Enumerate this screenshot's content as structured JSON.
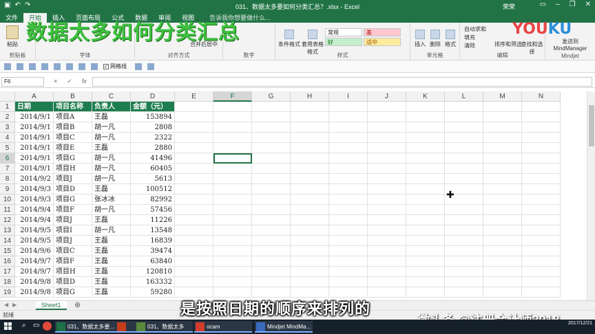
{
  "window": {
    "title": "031、数据太多要如何分类汇总？.xlsx - Excel",
    "user": "荣荣",
    "qat_icons": [
      "save-icon",
      "undo-icon",
      "redo-icon"
    ]
  },
  "overlay_title": "数据太多如何分类汇总",
  "ribbon": {
    "tabs": [
      "文件",
      "开始",
      "插入",
      "页面布局",
      "公式",
      "数据",
      "审阅",
      "视图"
    ],
    "active_tab": "开始",
    "tell_me": "告诉我你想要做什么...",
    "groups": [
      "剪贴板",
      "字体",
      "对齐方式",
      "数字",
      "样式",
      "单元格",
      "编辑",
      "Mindjet"
    ],
    "buttons": {
      "paste": "粘贴",
      "merge": "合并后居中",
      "conditional": "条件格式",
      "table_format": "套用表格格式",
      "insert": "插入",
      "delete": "删除",
      "format": "格式",
      "autosum": "自动求和",
      "fill": "填充",
      "clear": "清除",
      "sort_filter": "排序和筛选",
      "find_select": "查找和选择",
      "send_to": "发送到 MindManager"
    },
    "styles": {
      "normal": "常规",
      "bad": "差",
      "good": "好",
      "neutral": "适中"
    },
    "logo_main": "YOU",
    "logo_accent": "KU"
  },
  "toolbar2": {
    "gridlines_label": "网格线"
  },
  "formula_bar": {
    "name_box": "F6",
    "cancel": "×",
    "enter": "✓",
    "fx": "fx",
    "value": ""
  },
  "grid": {
    "columns": [
      "A",
      "B",
      "C",
      "D",
      "E",
      "F",
      "G",
      "H",
      "I",
      "J",
      "K",
      "L",
      "M",
      "N"
    ],
    "selected_column": "F",
    "selected_row": 6,
    "headers": [
      "日期",
      "项目名称",
      "负责人",
      "金额（元）"
    ],
    "rows": [
      [
        "2014/9/1",
        "项目A",
        "王磊",
        "153894"
      ],
      [
        "2014/9/1",
        "项目B",
        "胡一凡",
        "2808"
      ],
      [
        "2014/9/1",
        "项目C",
        "胡一凡",
        "2322"
      ],
      [
        "2014/9/1",
        "项目E",
        "王磊",
        "2880"
      ],
      [
        "2014/9/1",
        "项目G",
        "胡一凡",
        "41496"
      ],
      [
        "2014/9/1",
        "项目H",
        "胡一凡",
        "60405"
      ],
      [
        "2014/9/2",
        "项目J",
        "胡一凡",
        "5613"
      ],
      [
        "2014/9/3",
        "项目D",
        "王磊",
        "100512"
      ],
      [
        "2014/9/3",
        "项目G",
        "张冰冰",
        "82992"
      ],
      [
        "2014/9/4",
        "项目F",
        "胡一凡",
        "57456"
      ],
      [
        "2014/9/4",
        "项目J",
        "王磊",
        "11226"
      ],
      [
        "2014/9/5",
        "项目I",
        "胡一凡",
        "13548"
      ],
      [
        "2014/9/5",
        "项目J",
        "王磊",
        "16839"
      ],
      [
        "2014/9/6",
        "项目C",
        "王磊",
        "39474"
      ],
      [
        "2014/9/7",
        "项目F",
        "王磊",
        "63840"
      ],
      [
        "2014/9/7",
        "项目H",
        "王磊",
        "120810"
      ],
      [
        "2014/9/8",
        "项目D",
        "王磊",
        "163332"
      ],
      [
        "2014/9/8",
        "项目G",
        "王磊",
        "59280"
      ]
    ]
  },
  "sheet_tabs": [
    "Sheet1"
  ],
  "status": "就绪",
  "subtitle": "是按照日期的顺序来排列的",
  "watermark": "微头条 @注册会计师2018",
  "taskbar": {
    "items": [
      {
        "label": "031、数据太多要...",
        "icon": "excel-icon",
        "color": "#1e7145"
      },
      {
        "label": "",
        "icon": "powerpoint-icon",
        "color": "#c43e1c"
      },
      {
        "label": "031、数据太多要...",
        "icon": "app-icon",
        "color": "#5a8a3a"
      },
      {
        "label": "ocam",
        "icon": "ocam-icon",
        "color": "#d23c2c"
      },
      {
        "label": "Mindjet MindMa...",
        "icon": "mindjet-icon",
        "color": "#3a6bbf"
      }
    ],
    "date": "2017/12/21"
  }
}
